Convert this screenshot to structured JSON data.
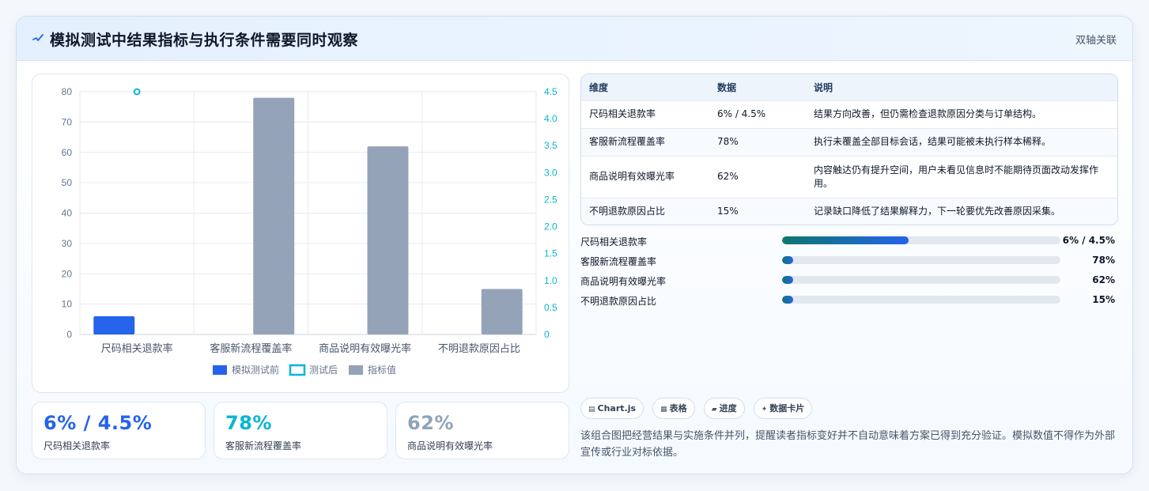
{
  "header": {
    "title": "模拟测试中结果指标与执行条件需要同时观察",
    "tag": "双轴关联",
    "icon": "pulse-icon"
  },
  "colors": {
    "accent": "#2563eb",
    "teal": "#06b6d4",
    "slate": "#94a3b8",
    "kpi_gray": "#8fa3b9"
  },
  "chart_data": {
    "type": "bar",
    "categories": [
      "尺码相关退款率",
      "客服新流程覆盖率",
      "商品说明有效曝光率",
      "不明退款原因占比"
    ],
    "series": [
      {
        "name": "模拟测试前",
        "axis": "left",
        "values": [
          6,
          null,
          null,
          null
        ]
      },
      {
        "name": "测试后",
        "axis": "right",
        "mark": "point",
        "values": [
          4.5,
          null,
          null,
          null
        ]
      },
      {
        "name": "指标值",
        "axis": "left",
        "values": [
          null,
          78,
          62,
          15
        ]
      }
    ],
    "y_left": {
      "min": 0,
      "max": 80,
      "ticks": [
        0,
        10,
        20,
        30,
        40,
        50,
        60,
        70,
        80
      ]
    },
    "y_right": {
      "min": 0,
      "max": 4.5,
      "ticks": [
        "0",
        "0.5",
        "1.0",
        "1.5",
        "2.0",
        "2.5",
        "3.0",
        "3.5",
        "4.0",
        "4.5"
      ]
    },
    "grid": true,
    "legend_position": "bottom"
  },
  "kpis": [
    {
      "value": "6% / 4.5%",
      "label": "尺码相关退款率"
    },
    {
      "value": "78%",
      "label": "客服新流程覆盖率"
    },
    {
      "value": "62%",
      "label": "商品说明有效曝光率"
    }
  ],
  "table": {
    "headers": [
      "维度",
      "数据",
      "说明"
    ],
    "rows": [
      [
        "尺码相关退款率",
        "6% / 4.5%",
        "结果方向改善，但仍需检查退款原因分类与订单结构。"
      ],
      [
        "客服新流程覆盖率",
        "78%",
        "执行未覆盖全部目标会话，结果可能被未执行样本稀释。"
      ],
      [
        "商品说明有效曝光率",
        "62%",
        "内容触达仍有提升空间，用户未看见信息时不能期待页面改动发挥作用。"
      ],
      [
        "不明退款原因占比",
        "15%",
        "记录缺口降低了结果解释力，下一轮要优先改善原因采集。"
      ]
    ]
  },
  "progress": [
    {
      "label": "尺码相关退款率",
      "value": "6% / 4.5%",
      "fraction": 0.455
    },
    {
      "label": "客服新流程覆盖率",
      "value": "78%",
      "fraction": 0.04
    },
    {
      "label": "商品说明有效曝光率",
      "value": "62%",
      "fraction": 0.04
    },
    {
      "label": "不明退款原因占比",
      "value": "15%",
      "fraction": 0.04
    }
  ],
  "chips": [
    {
      "icon": "chart-icon",
      "label": "Chart.js"
    },
    {
      "icon": "table-icon",
      "label": "表格"
    },
    {
      "icon": "progress-icon",
      "label": "进度"
    },
    {
      "icon": "spark-icon",
      "label": "数据卡片"
    }
  ],
  "note": "该组合图把经营结果与实施条件并列，提醒读者指标变好并不自动意味着方案已得到充分验证。模拟数值不得作为外部宣传或行业对标依据。"
}
